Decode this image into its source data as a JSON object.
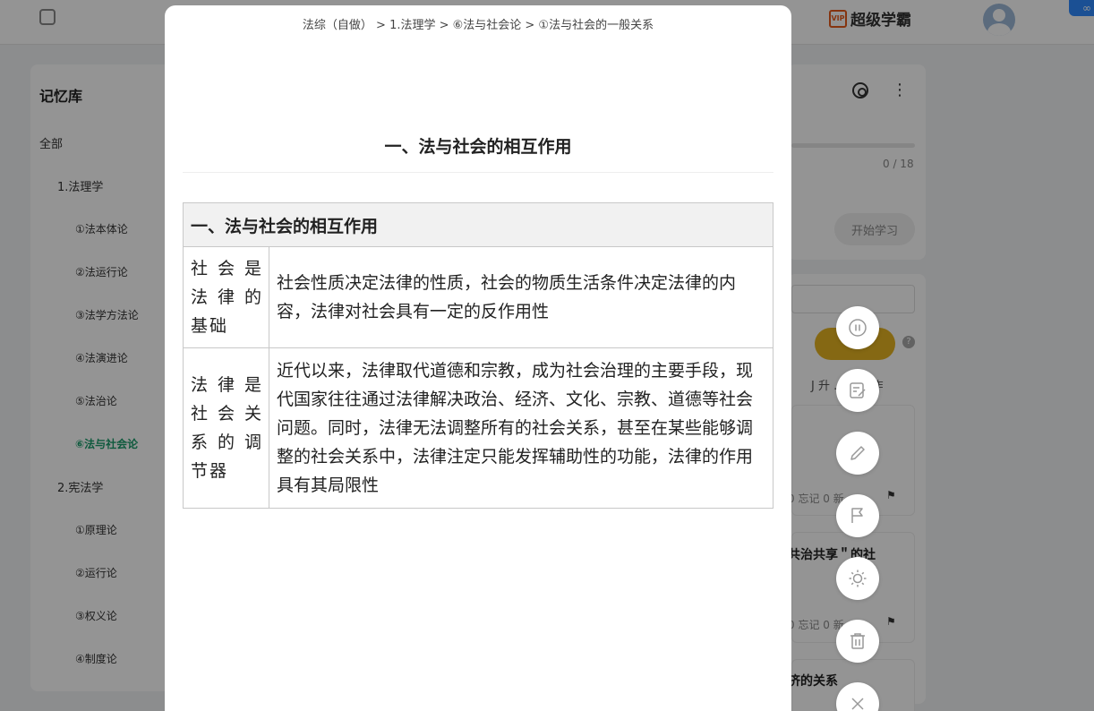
{
  "app": {
    "brand": "超级学霸",
    "vip_badge": "VIP"
  },
  "sidebar": {
    "title": "记忆库",
    "items": [
      {
        "label": "全部",
        "level": 0
      },
      {
        "label": "1.法理学",
        "level": 1
      },
      {
        "label": "①法本体论",
        "level": 2
      },
      {
        "label": "②法运行论",
        "level": 2
      },
      {
        "label": "③法学方法论",
        "level": 2
      },
      {
        "label": "④法演进论",
        "level": 2
      },
      {
        "label": "⑤法治论",
        "level": 2
      },
      {
        "label": "⑥法与社会论",
        "level": 2,
        "active": true
      },
      {
        "label": "2.宪法学",
        "level": 1
      },
      {
        "label": "①原理论",
        "level": 2
      },
      {
        "label": "②运行论",
        "level": 2
      },
      {
        "label": "③权义论",
        "level": 2
      },
      {
        "label": "④制度论",
        "level": 2
      }
    ]
  },
  "right_panel": {
    "progress_text": "0 / 18",
    "progress_fraction": 0,
    "start_button": "开始学习",
    "sort_text": "J 升 ... 量操作",
    "card_meta": "0 忘记 0 新",
    "card2_title": "共治共享＂的社",
    "card3_title": "济的关系"
  },
  "modal": {
    "breadcrumb": "法综（自做） > 1.法理学 > ⑥法与社会论 > ①法与社会的一般关系",
    "title": "一、法与社会的相互作用",
    "table": {
      "header": "一、法与社会的相互作用",
      "rows": [
        {
          "head": "社会是法律的基础",
          "body": "社会性质决定法律的性质，社会的物质生活条件决定法律的内容，法律对社会具有一定的反作用性"
        },
        {
          "head": "法律是社会关系的调节器",
          "body": "近代以来，法律取代道德和宗教，成为社会治理的主要手段，现代国家往往通过法律解决政治、经济、文化、宗教、道德等社会问题。同时，法律无法调整所有的社会关系，甚至在某些能够调整的社会关系中，法律注定只能发挥辅助性的功能，法律的作用具有其局限性"
        }
      ]
    }
  },
  "fabs": [
    {
      "icon": "pause-icon"
    },
    {
      "icon": "edit-note-icon"
    },
    {
      "icon": "pencil-icon"
    },
    {
      "icon": "flag-icon"
    },
    {
      "icon": "brightness-icon"
    },
    {
      "icon": "trash-icon"
    },
    {
      "icon": "close-icon"
    }
  ],
  "colors": {
    "active_green": "#1b9c6b",
    "overlay": "rgba(0,0,0,0.42)",
    "yellow_button": "#e6b422"
  }
}
